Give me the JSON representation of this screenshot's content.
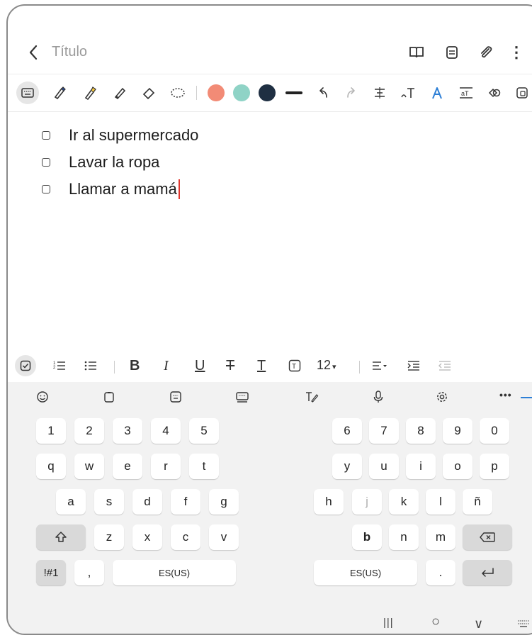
{
  "header": {
    "back_icon": "chevron-left",
    "title_placeholder": "Título",
    "icons": [
      "book-icon",
      "reader-icon",
      "attach-icon",
      "more-vert-icon"
    ],
    "more_glyph": "⋮"
  },
  "pen_toolbar": {
    "colors": {
      "salmon": "#f28b76",
      "teal": "#8fd3c6",
      "navy": "#1f2f42",
      "line": "#222222"
    }
  },
  "checklist": {
    "items": [
      {
        "label": "Ir al supermercado",
        "checked": false
      },
      {
        "label": "Lavar la ropa",
        "checked": false
      },
      {
        "label": "Llamar a mamá",
        "checked": false
      }
    ]
  },
  "format_bar": {
    "bold": "B",
    "italic": "I",
    "underline": "U",
    "strike": "T",
    "text_t": "T",
    "font_size": "12",
    "dropdown_caret": "▾"
  },
  "keyboard": {
    "toolbar_more": "•••",
    "numbers_left": [
      "1",
      "2",
      "3",
      "4",
      "5"
    ],
    "numbers_right": [
      "6",
      "7",
      "8",
      "9",
      "0"
    ],
    "row1_left": [
      "q",
      "w",
      "e",
      "r",
      "t"
    ],
    "row1_right": [
      "y",
      "u",
      "i",
      "o",
      "p"
    ],
    "row2_left": [
      "a",
      "s",
      "d",
      "f",
      "g"
    ],
    "row2_right": [
      "h",
      "j",
      "k",
      "l",
      "ñ"
    ],
    "row3_left": [
      "z",
      "x",
      "c",
      "v"
    ],
    "row3_right": [
      "b",
      "n",
      "m"
    ],
    "symbols": "!#1",
    "comma": ",",
    "space_left": "ES(US)",
    "space_right": "ES(US)",
    "period": "."
  },
  "navbar": {
    "recents": "|||",
    "home": "○",
    "back": "∨"
  },
  "accent_color": "#2d7fd6"
}
